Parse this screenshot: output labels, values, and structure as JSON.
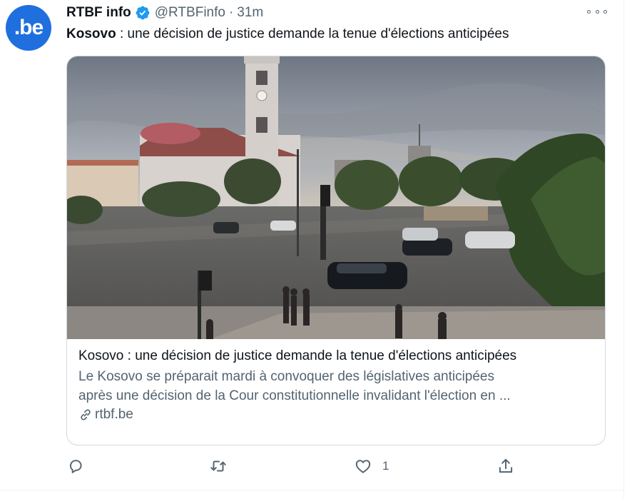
{
  "account": {
    "avatar_text": ".be",
    "name": "RTBF info",
    "handle": "@RTBFinfo",
    "separator": "·",
    "time": "31m"
  },
  "tweet": {
    "bold_prefix": "Kosovo",
    "text_rest": " : une décision de justice demande la tenue d'élections anticipées"
  },
  "card": {
    "title": "Kosovo : une décision de justice demande la tenue d'élections anticipées",
    "desc_line1": "Le Kosovo se préparait mardi à convoquer des législatives anticipées",
    "desc_line2": "après une décision de la Cour constitutionnelle invalidant l'élection en ...",
    "domain": "rtbf.be"
  },
  "actions": {
    "reply_icon": "reply-icon",
    "retweet_icon": "retweet-icon",
    "like_icon": "like-icon",
    "like_count": "1",
    "share_icon": "share-icon"
  },
  "colors": {
    "avatar_bg": "#1f6fde",
    "verified": "#1d9bf0",
    "secondary_text": "#536471",
    "border": "#cfd9de"
  }
}
